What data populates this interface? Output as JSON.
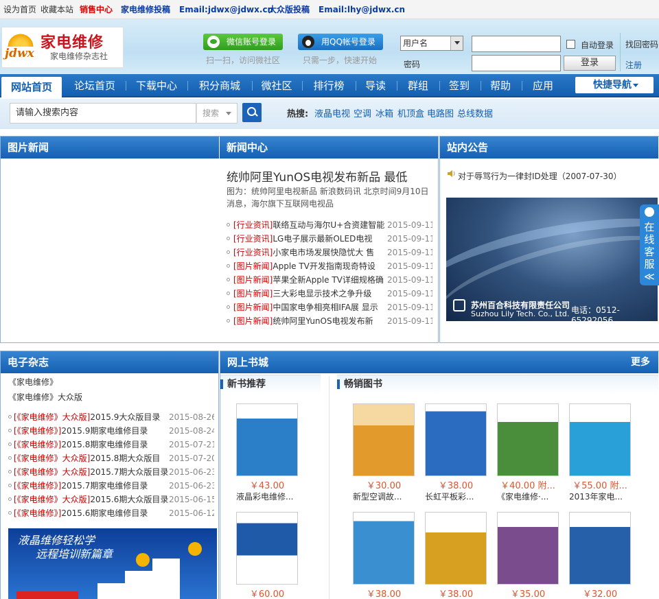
{
  "topbar": {
    "set_home": "设为首页",
    "bookmark": "收藏本站",
    "sales": "销售中心",
    "contribute": "家电维修投稿",
    "email1": "Email:jdwx@jdwx.cn",
    "popular_contribute": "大众版投稿",
    "email2": "Email:lhy@jdwx.cn"
  },
  "logo": {
    "short": "jdwx",
    "title": "家电维修",
    "subtitle": "家电维修杂志社"
  },
  "social_login": {
    "wechat": {
      "label": "微信账号登录",
      "hint": "扫一扫，访问微社区"
    },
    "qq": {
      "label": "用QQ帐号登录",
      "hint": "只需一步，快速开始"
    }
  },
  "login": {
    "username_select": "用户名",
    "password_label": "密码",
    "auto_login": "自动登录",
    "login_button": "登录",
    "forgot": "找回密码",
    "register": "注册"
  },
  "nav": {
    "items": [
      "网站首页",
      "论坛首页",
      "下载中心",
      "积分商城",
      "微社区",
      "排行榜",
      "导读",
      "群组",
      "签到",
      "帮助",
      "应用"
    ],
    "quick": "快捷导航"
  },
  "search": {
    "placeholder": "请输入搜索内容",
    "type": "搜索",
    "hot_label": "热搜:",
    "hot": [
      "液晶电视",
      "空调",
      "冰箱",
      "机顶盒",
      "电路图",
      "总线数据"
    ]
  },
  "panels": {
    "photo_news": "图片新闻",
    "news_center": "新闻中心",
    "announcements": "站内公告",
    "magazine": "电子杂志",
    "bookstore": "网上书城",
    "more": "更多"
  },
  "headline": {
    "title": "统帅阿里YunOS电视发布新品  最低",
    "desc": "图为：统帅阿里电视新品        新浪数码讯  北京时间9月10日消息，海尔旗下互联网电视品"
  },
  "news_list": [
    {
      "tag": "[行业资讯]",
      "title": "联络互动与海尔U+合资建智能",
      "date": "2015-09-11"
    },
    {
      "tag": "[行业资讯]",
      "title": "LG电子展示最新OLED电视",
      "date": "2015-09-11"
    },
    {
      "tag": "[行业资讯]",
      "title": "小家电市场发展快隐忧大  售",
      "date": "2015-09-11"
    },
    {
      "tag": "[图片新闻]",
      "title": "Apple TV开发指南现奇特设",
      "date": "2015-09-11"
    },
    {
      "tag": "[图片新闻]",
      "title": "苹果全新Apple TV详细规格确",
      "date": "2015-09-11"
    },
    {
      "tag": "[图片新闻]",
      "title": "三大彩电显示技术之争升级",
      "date": "2015-09-11"
    },
    {
      "tag": "[图片新闻]",
      "title": "中国家电争相亮相IFA展  显示",
      "date": "2015-09-11"
    },
    {
      "tag": "[图片新闻]",
      "title": "统帅阿里YunOS电视发布新",
      "date": "2015-09-11"
    }
  ],
  "notice": {
    "item": "对于辱骂行为一律封ID处理（2007-07-30）",
    "banner_company_cn": "苏州百合科技有限责任公司",
    "banner_company_en": "Suzhou Lily Tech. Co., Ltd.",
    "banner_phone": "电话：0512-65292056"
  },
  "kefu": "在线客服",
  "magazine": {
    "links": [
      "《家电维修》",
      "《家电维修》大众版"
    ],
    "list": [
      {
        "tag": "[《家电维修》大众版]",
        "title": "2015.9大众版目录",
        "date": "2015-08-26"
      },
      {
        "tag": "[《家电维修》]",
        "title": "2015.9期家电维修目录",
        "date": "2015-08-24"
      },
      {
        "tag": "[《家电维修》]",
        "title": "2015.8期家电维修目录",
        "date": "2015-07-21"
      },
      {
        "tag": "[《家电维修》大众版]",
        "title": "2015.8期大众版目",
        "date": "2015-07-20"
      },
      {
        "tag": "[《家电维修》大众版]",
        "title": "2015.7期大众版目录",
        "date": "2015-06-23"
      },
      {
        "tag": "[《家电维修》]",
        "title": "2015.7期家电维修目录",
        "date": "2015-06-23"
      },
      {
        "tag": "[《家电维修》大众版]",
        "title": "2015.6期大众版目录",
        "date": "2015-06-15"
      },
      {
        "tag": "[《家电维修》]",
        "title": "2015.6期家电维修目录",
        "date": "2015-06-12"
      }
    ],
    "ad_line1": "液晶维修轻松学",
    "ad_line2": "远程培训新篇章"
  },
  "bookstore": {
    "new_books": "新书推荐",
    "bestsellers": "畅销图书",
    "new": [
      {
        "price": "￥43.00",
        "name": "液晶彩电维修...",
        "color": "#2b7fc8"
      },
      {
        "price": "￥60.00",
        "name": "",
        "color": "#1e5aa8"
      }
    ],
    "best": [
      {
        "price": "￥30.00",
        "name": "新型空调故...",
        "color": "#e39a2c"
      },
      {
        "price": "￥38.00",
        "name": "长虹平板彩...",
        "color": "#2b6bc0"
      },
      {
        "price": "￥40.00 附...",
        "name": "《家电维修·...",
        "color": "#4a8e3c"
      },
      {
        "price": "￥55.00 附...",
        "name": "2013年家电...",
        "color": "#2aa0d8"
      },
      {
        "price": "￥38.00",
        "name": "",
        "color": "#3a8fd0"
      },
      {
        "price": "￥38.00",
        "name": "",
        "color": "#d8a020"
      },
      {
        "price": "￥35.00",
        "name": "",
        "color": "#7a4c8e"
      },
      {
        "price": "￥32.00",
        "name": "",
        "color": "#2560a8"
      }
    ]
  }
}
